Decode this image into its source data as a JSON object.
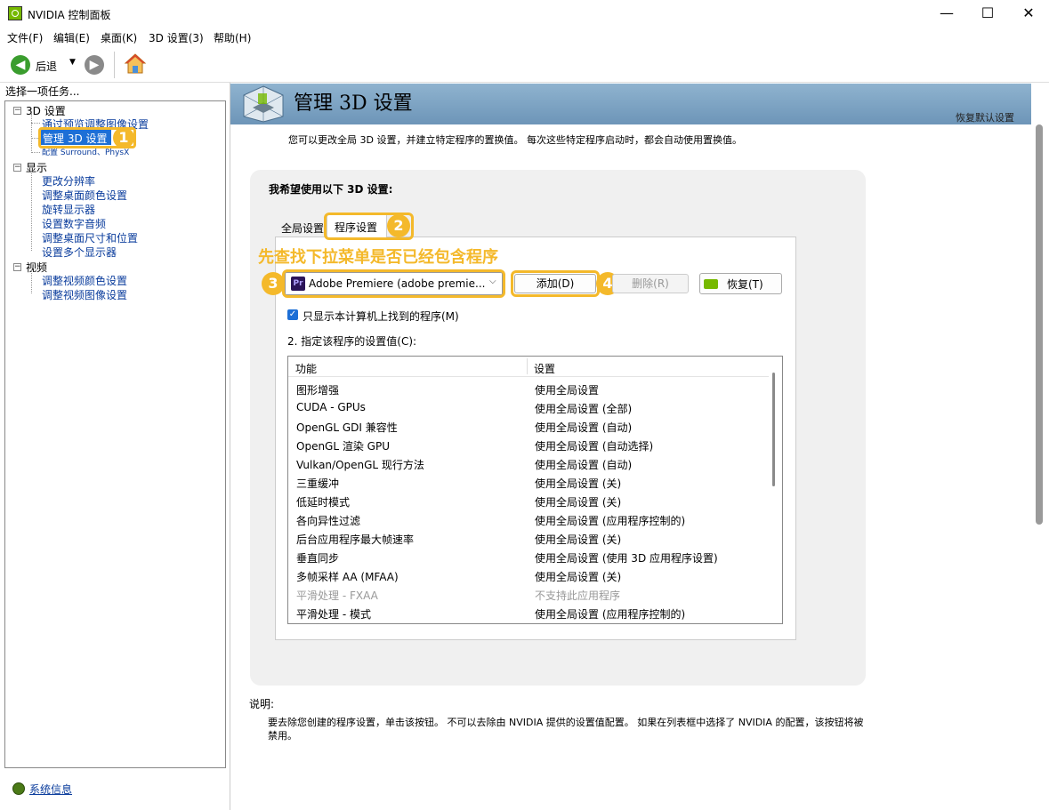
{
  "window": {
    "title": "NVIDIA 控制面板",
    "min": "—",
    "max": "☐",
    "close": "✕"
  },
  "menu": [
    "文件(F)",
    "编辑(E)",
    "桌面(K)",
    "3D 设置(3)",
    "帮助(H)"
  ],
  "toolbar": {
    "back_label": "后退"
  },
  "left": {
    "header": "选择一项任务...",
    "tree": [
      {
        "label": "3D 设置",
        "children": [
          "通过预览调整图像设置",
          "管理 3D 设置",
          "配置 Surround、PhysX"
        ]
      },
      {
        "label": "显示",
        "children": [
          "更改分辨率",
          "调整桌面颜色设置",
          "旋转显示器",
          "设置数字音频",
          "调整桌面尺寸和位置",
          "设置多个显示器"
        ]
      },
      {
        "label": "视频",
        "children": [
          "调整视频颜色设置",
          "调整视频图像设置"
        ]
      }
    ],
    "system_info": "系统信息"
  },
  "main": {
    "title": "管理 3D 设置",
    "restore_defaults": "恢复默认设置",
    "intro": "您可以更改全局 3D 设置，并建立特定程序的置换值。 每次这些特定程序启动时，都会自动使用置换值。",
    "card_title": "我希望使用以下 3D 设置:",
    "tabs": [
      "全局设置",
      "程序设置"
    ],
    "annotation": "先查找下拉菜单是否已经包含程序",
    "program_select": "Adobe Premiere (adobe premie...",
    "program_icon_text": "Pr",
    "buttons": {
      "add": "添加(D)",
      "remove": "删除(R)",
      "restore": "恢复(T)"
    },
    "checkbox_label": "只显示本计算机上找到的程序(M)",
    "step2_label": "2. 指定该程序的设置值(C):",
    "table_headers": [
      "功能",
      "设置"
    ],
    "table_rows": [
      [
        "图形增强",
        "使用全局设置"
      ],
      [
        "CUDA - GPUs",
        "使用全局设置 (全部)"
      ],
      [
        "OpenGL GDI 兼容性",
        "使用全局设置 (自动)"
      ],
      [
        "OpenGL 渲染 GPU",
        "使用全局设置 (自动选择)"
      ],
      [
        "Vulkan/OpenGL 现行方法",
        "使用全局设置 (自动)"
      ],
      [
        "三重缓冲",
        "使用全局设置 (关)"
      ],
      [
        "低延时模式",
        "使用全局设置 (关)"
      ],
      [
        "各向异性过滤",
        "使用全局设置 (应用程序控制的)"
      ],
      [
        "后台应用程序最大帧速率",
        "使用全局设置 (关)"
      ],
      [
        "垂直同步",
        "使用全局设置 (使用 3D 应用程序设置)"
      ],
      [
        "多帧采样 AA (MFAA)",
        "使用全局设置 (关)"
      ],
      [
        "平滑处理 - FXAA",
        "不支持此应用程序"
      ],
      [
        "平滑处理 - 模式",
        "使用全局设置 (应用程序控制的)"
      ]
    ],
    "description_label": "说明:",
    "description_text": "要去除您创建的程序设置，单击该按钮。 不可以去除由 NVIDIA 提供的设置值配置。 如果在列表框中选择了 NVIDIA 的配置，该按钮将被禁用。",
    "badges": [
      "1",
      "2",
      "3",
      "4"
    ]
  },
  "colors": {
    "accent": "#f4b92b",
    "nvidia_green": "#76b900",
    "link": "#0a3c9c",
    "banner": "#7fa6c6"
  }
}
